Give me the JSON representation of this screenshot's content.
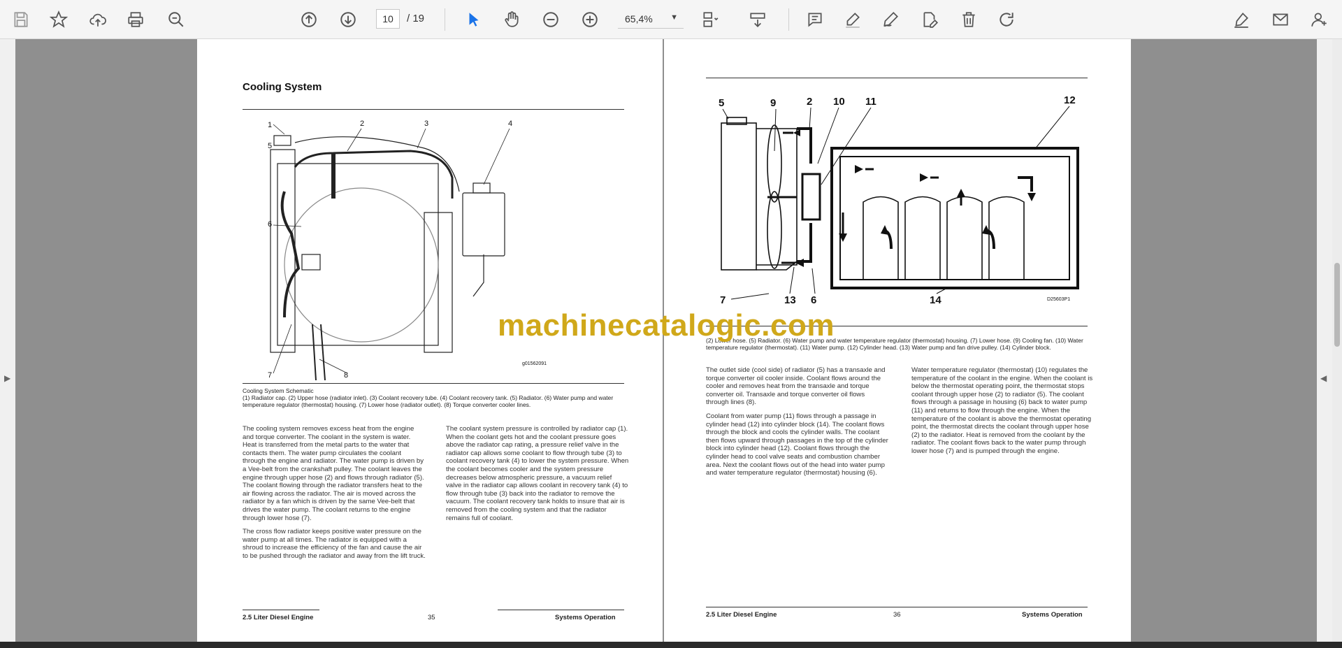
{
  "toolbar": {
    "current_page": "10",
    "total_pages": "/ 19",
    "zoom": "65,4%"
  },
  "page_left": {
    "title": "Cooling System",
    "figure_code": "g01562091",
    "callouts": [
      "1",
      "5",
      "2",
      "3",
      "4",
      "6",
      "7",
      "8"
    ],
    "caption_title": "Cooling System Schematic",
    "caption_text": "(1) Radiator cap. (2) Upper hose (radiator inlet). (3) Coolant recovery tube. (4) Coolant recovery tank. (5) Radiator. (6) Water pump and water temperature regulator (thermostat) housing. (7) Lower hose (radiator outlet). (8) Torque converter cooler lines.",
    "col1": [
      "The cooling system removes excess heat from the engine and torque converter. The coolant in the system is water. Heat is transferred from the metal parts to the water that contacts them. The water pump circulates the coolant through the engine and radiator. The water pump is driven by a Vee-belt from the crankshaft pulley. The coolant leaves the engine through upper hose (2) and flows through radiator (5). The coolant flowing through the radiator transfers heat to the air flowing across the radiator. The air is moved across the radiator by a fan which is driven by the same Vee-belt that drives the water pump. The coolant returns to the engine through lower hose (7).",
      "The cross flow radiator keeps positive water pressure on the water pump at all times. The radiator is equipped with a shroud to increase the efficiency of the fan and cause the air to be pushed through the radiator and away from the lift truck."
    ],
    "col2": [
      "The coolant system pressure is controlled by radiator cap (1). When the coolant gets hot and the coolant pressure goes above the radiator cap rating, a pressure relief valve in the radiator cap allows some coolant to flow through tube (3) to coolant recovery tank (4) to lower the system pressure. When the coolant becomes cooler and the system pressure decreases below atmospheric pressure, a vacuum relief valve in the radiator cap allows coolant in recovery tank (4) to flow through tube (3) back into the radiator to remove the vacuum. The coolant recovery tank holds to insure that air is removed from the cooling system and that the radiator remains full of coolant."
    ],
    "footer_left": "2.5 Liter Diesel Engine",
    "footer_page": "35",
    "footer_right": "Systems Operation"
  },
  "page_right": {
    "figure_code": "D25603P1",
    "callouts": [
      "5",
      "9",
      "2",
      "10",
      "11",
      "12",
      "7",
      "13",
      "6",
      "14"
    ],
    "caption_text": "(2) Lower hose. (5) Radiator. (6) Water pump and water temperature regulator (thermostat) housing. (7) Lower hose. (9) Cooling fan. (10) Water temperature regulator (thermostat). (11) Water pump. (12) Cylinder head. (13) Water pump and fan drive pulley. (14) Cylinder block.",
    "col1": [
      "The outlet side (cool side) of radiator (5) has a transaxle and torque converter oil cooler inside. Coolant flows around the cooler and removes heat from the transaxle and torque converter oil. Transaxle and torque converter oil flows through lines (8).",
      "Coolant from water pump (11) flows through a passage in cylinder head (12) into cylinder block (14). The coolant flows through the block and cools the cylinder walls. The coolant then flows upward through passages in the top of the cylinder block into cylinder head (12). Coolant flows through the cylinder head to cool valve seats and combustion chamber area. Next the coolant flows out of the head into water pump and water temperature regulator (thermostat) housing (6)."
    ],
    "col2": [
      "Water temperature regulator (thermostat) (10) regulates the temperature of the coolant in the engine. When the coolant is below the thermostat operating point, the thermostat stops coolant through upper hose (2) to radiator (5). The coolant flows through a passage in housing (6) back to water pump (11) and returns to flow through the engine. When the temperature of the coolant is above the thermostat operating point, the thermostat directs the coolant through upper hose (2) to the radiator. Heat is removed from the coolant by the radiator. The coolant flows back to the water pump through lower hose (7) and is pumped through the engine."
    ],
    "footer_left": "2.5 Liter Diesel Engine",
    "footer_page": "36",
    "footer_right": "Systems Operation"
  },
  "watermark": "machinecatalogic.com"
}
